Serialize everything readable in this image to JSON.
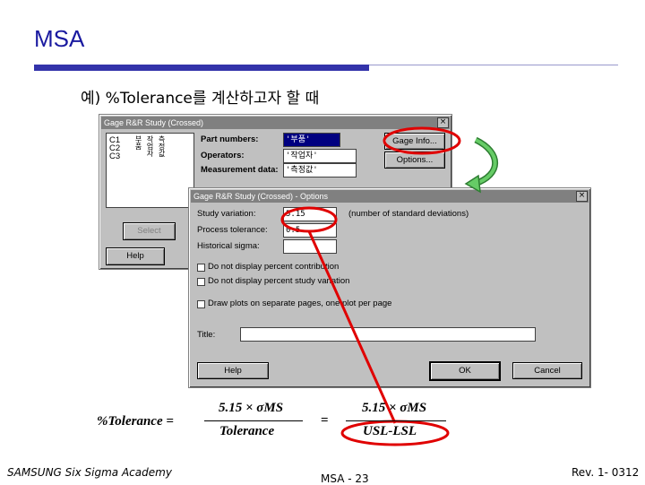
{
  "slide": {
    "title": "MSA",
    "subtitle": "예) %Tolerance를 계산하고자 할 때",
    "footer_left": "SAMSUNG Six Sigma Academy",
    "footer_center": "MSA - 23",
    "footer_right": "Rev. 1- 0312"
  },
  "dialog_main": {
    "title": "Gage R&R Study (Crossed)",
    "close": "×",
    "columns": [
      {
        "id": "C1",
        "name": "부품"
      },
      {
        "id": "C2",
        "name": "작업자"
      },
      {
        "id": "C3",
        "name": "측정값"
      }
    ],
    "part_numbers_label": "Part numbers:",
    "part_numbers_value": "'부품'",
    "operators_label": "Operators:",
    "operators_value": "'작업자'",
    "measurement_label": "Measurement data:",
    "measurement_value": "'측정값'",
    "gage_info_button": "Gage Info...",
    "options_button": "Options...",
    "select_button": "Select",
    "help_button": "Help"
  },
  "dialog_options": {
    "title": "Gage R&R Study (Crossed) - Options",
    "close": "×",
    "study_variation_label": "Study variation:",
    "study_variation_value": "5.15",
    "study_variation_note": "(number of standard deviations)",
    "process_tolerance_label": "Process tolerance:",
    "process_tolerance_value": "0.5",
    "historical_sigma_label": "Historical sigma:",
    "historical_sigma_value": "",
    "check1": "Do not display percent contribution",
    "check2": "Do not display percent study variation",
    "check3": "Draw plots on separate pages, one plot per page",
    "title_label": "Title:",
    "title_value": "",
    "help_button": "Help",
    "ok_button": "OK",
    "cancel_button": "Cancel"
  },
  "formula": {
    "lhs": "%Tolerance =",
    "num1": "5.15 × σMS",
    "den1": "Tolerance",
    "eq": "=",
    "num2": "5.15 × σMS",
    "den2": "USL-LSL"
  },
  "colors": {
    "accent": "#1a1aa0",
    "highlight": "#e00000",
    "arrow": "#33aa55"
  }
}
